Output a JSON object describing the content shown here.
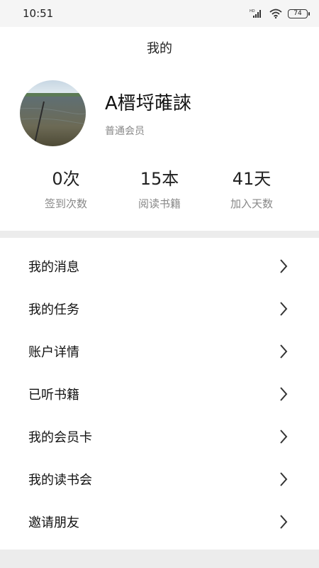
{
  "status_bar": {
    "time": "10:51",
    "battery": "74",
    "icons": [
      "hd-signal-icon",
      "wifi-icon",
      "battery-icon"
    ]
  },
  "header": {
    "title": "我的"
  },
  "profile": {
    "name": "A榗埒蓶誺",
    "level": "普通会员",
    "avatar_icon": "avatar-lake-photo"
  },
  "stats": [
    {
      "value": "0次",
      "label": "签到次数"
    },
    {
      "value": "15本",
      "label": "阅读书籍"
    },
    {
      "value": "41天",
      "label": "加入天数"
    }
  ],
  "menu": [
    {
      "label": "我的消息"
    },
    {
      "label": "我的任务"
    },
    {
      "label": "账户详情"
    },
    {
      "label": "已听书籍"
    },
    {
      "label": "我的会员卡"
    },
    {
      "label": "我的读书会"
    },
    {
      "label": "邀请朋友"
    }
  ],
  "colors": {
    "divider": "#ececec",
    "secondary_text": "#888888",
    "primary_text": "#111111"
  }
}
